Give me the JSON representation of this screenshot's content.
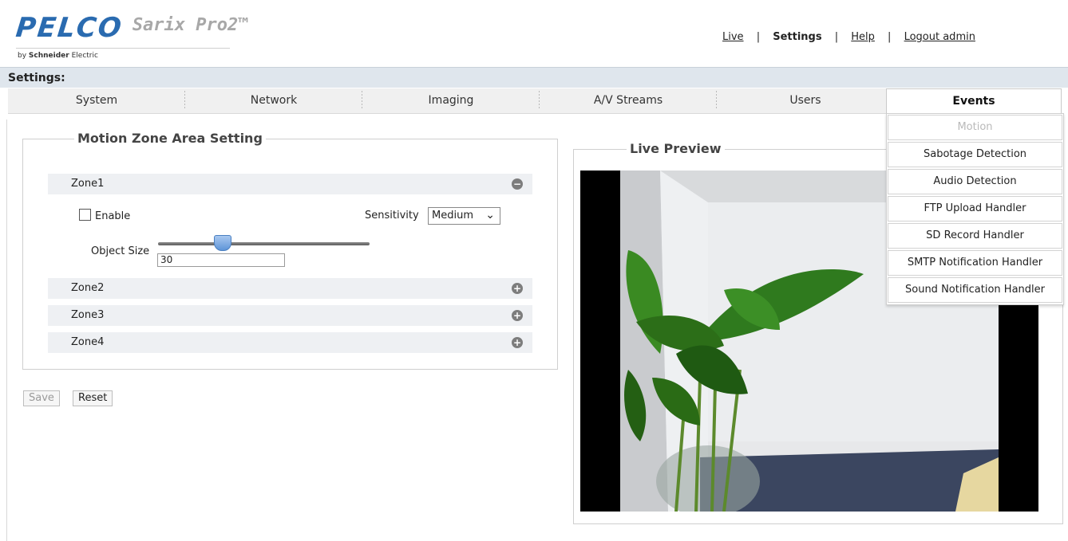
{
  "brand": {
    "logo": "PELCO",
    "product": "Sarix Pro2™",
    "byline_by": "by",
    "byline_company": "Schneider",
    "byline_suffix": "Electric"
  },
  "topnav": {
    "live": "Live",
    "settings": "Settings",
    "help": "Help",
    "logout": "Logout admin",
    "separator": "|"
  },
  "settings_bar": {
    "title": "Settings:"
  },
  "tabs": [
    {
      "label": "System"
    },
    {
      "label": "Network"
    },
    {
      "label": "Imaging"
    },
    {
      "label": "A/V Streams"
    },
    {
      "label": "Users"
    },
    {
      "label": "Events",
      "active": true
    }
  ],
  "events_menu": [
    {
      "label": "Motion",
      "disabled": true
    },
    {
      "label": "Sabotage Detection"
    },
    {
      "label": "Audio Detection"
    },
    {
      "label": "FTP Upload Handler"
    },
    {
      "label": "SD Record Handler"
    },
    {
      "label": "SMTP Notification Handler"
    },
    {
      "label": "Sound Notification Handler"
    }
  ],
  "motion_zone": {
    "legend": "Motion Zone Area Setting",
    "zones": [
      {
        "label": "Zone1",
        "toggle": "−",
        "expanded": true
      },
      {
        "label": "Zone2",
        "toggle": "+"
      },
      {
        "label": "Zone3",
        "toggle": "+"
      },
      {
        "label": "Zone4",
        "toggle": "+"
      }
    ],
    "enable_label": "Enable",
    "enable_checked": false,
    "sensitivity_label": "Sensitivity",
    "sensitivity_value": "Medium",
    "object_size_label": "Object Size",
    "object_size_value": "30",
    "object_size_fraction": 0.3
  },
  "buttons": {
    "save": "Save",
    "reset": "Reset"
  },
  "live_preview": {
    "legend": "Live Preview"
  },
  "colors": {
    "accent": "#2a6bb0",
    "tab_bar": "#f0f0f0",
    "settings_bar": "#dfe6ed"
  },
  "icons": {
    "zone_collapse": "minus-circle-icon",
    "zone_expand": "plus-circle-icon",
    "select_arrow": "chevron-down-icon"
  }
}
